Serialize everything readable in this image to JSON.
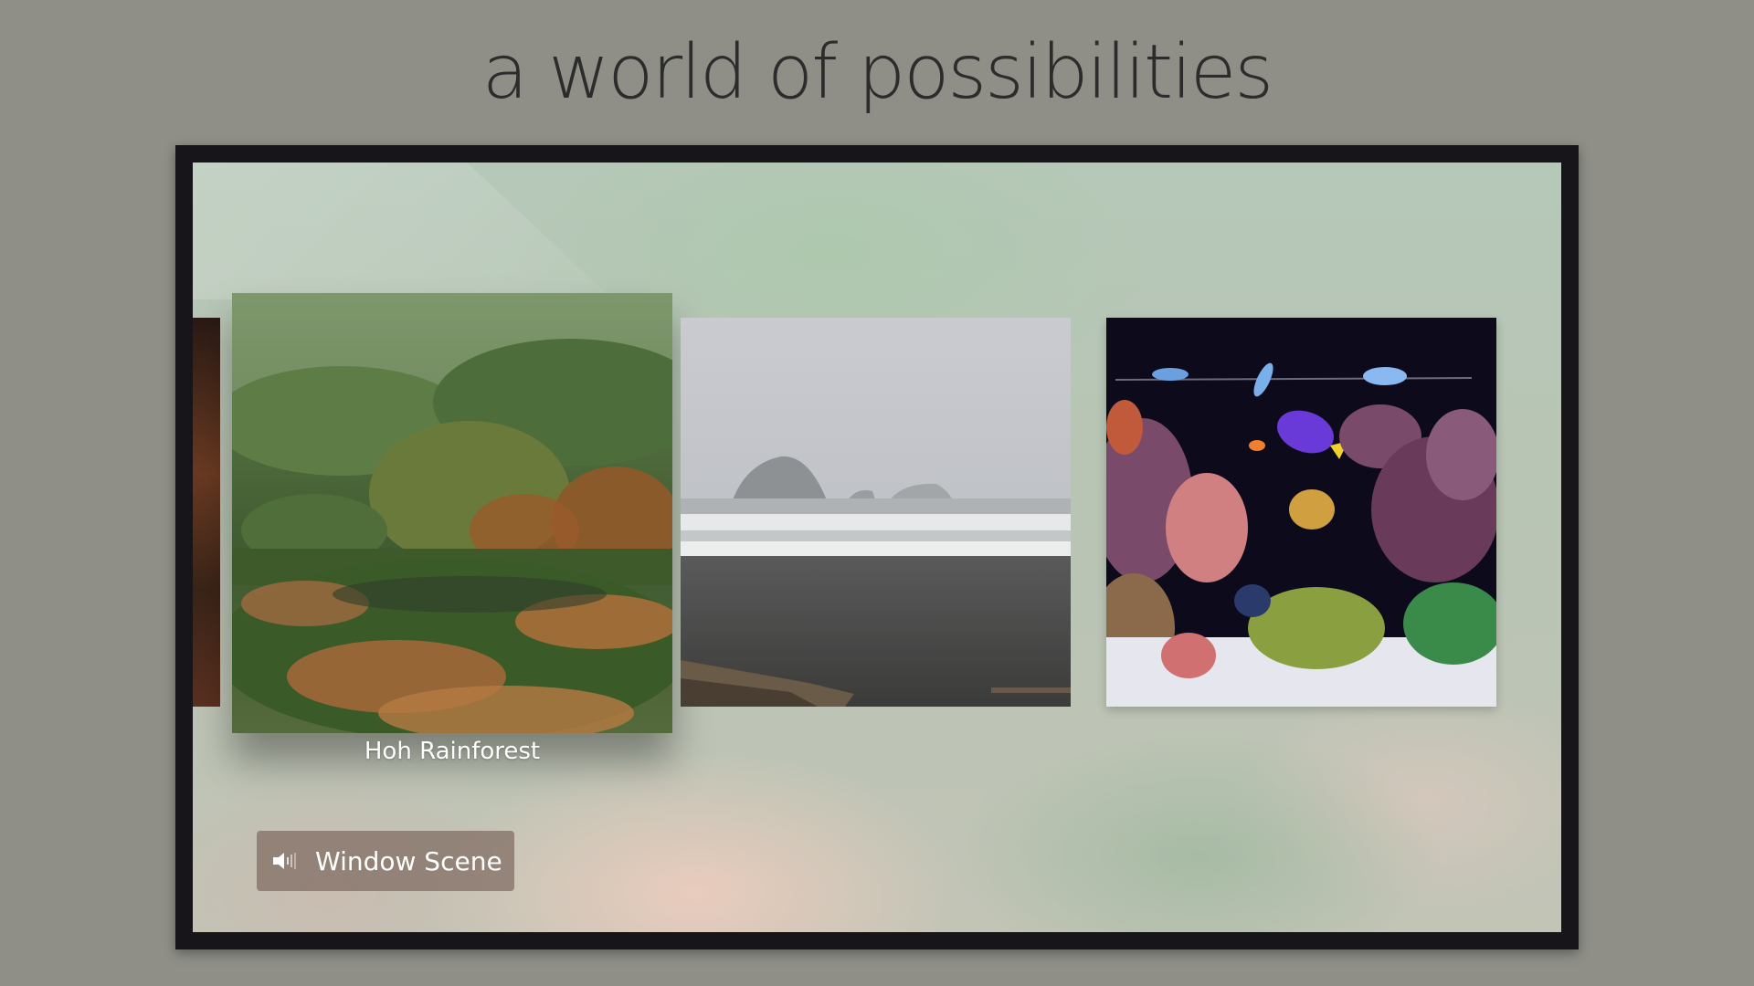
{
  "headline": "a world of possibilities",
  "carousel": {
    "focused_caption": "Hoh Rainforest",
    "tiles": [
      {
        "scene": "partial-previous"
      },
      {
        "scene": "forest"
      },
      {
        "scene": "misty-beach"
      },
      {
        "scene": "coral-reef-aquarium"
      }
    ]
  },
  "now_playing": {
    "icon": "speaker-icon",
    "label": "Window Scene"
  }
}
